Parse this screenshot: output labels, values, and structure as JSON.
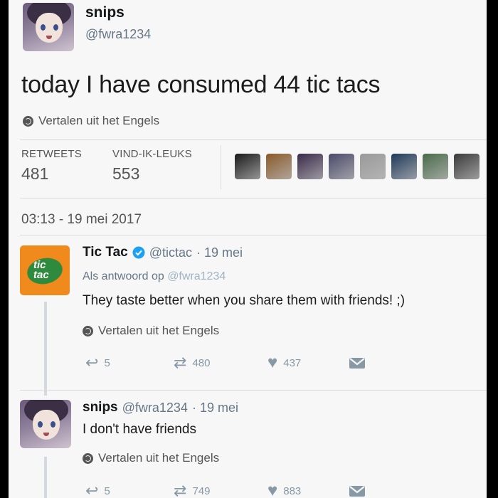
{
  "tweet": {
    "author_name": "snips",
    "author_handle": "@fwra1234",
    "text": "today I have consumed 44 tic tacs",
    "translate_label": "Vertalen uit het Engels",
    "retweets_label": "RETWEETS",
    "retweets_count": "481",
    "likes_label": "VIND-IK-LEUKS",
    "likes_count": "553",
    "timestamp": "03:13 - 19 mei 2017",
    "liker_avatar_colors": [
      "#1a1a1a",
      "#8a5a2b",
      "#3a2a4a",
      "#4a4a6a",
      "#9a9a9a",
      "#1f3a5a",
      "#4a6a4a",
      "#3a3a3a"
    ]
  },
  "replies": [
    {
      "author_name": "Tic Tac",
      "verified": true,
      "author_handle": "@tictac",
      "date": "· 19 mei",
      "reply_to_prefix": "Als antwoord op",
      "reply_to_handle": "@fwra1234",
      "logo_text_1": "tic",
      "logo_text_2": "tac",
      "text": "They taste better when you share them with friends! ;)",
      "translate_label": "Vertalen uit het Engels",
      "reply_count": "5",
      "retweet_count": "480",
      "like_count": "437"
    },
    {
      "author_name": "snips",
      "author_handle": "@fwra1234",
      "date": "· 19 mei",
      "text": "I don't have friends",
      "translate_label": "Vertalen uit het Engels",
      "reply_count": "5",
      "retweet_count": "749",
      "like_count": "883"
    }
  ],
  "colors": {
    "verified": "#1da1f2",
    "tictac_orange": "#f08a1c",
    "tictac_green": "#2e8b3e"
  }
}
